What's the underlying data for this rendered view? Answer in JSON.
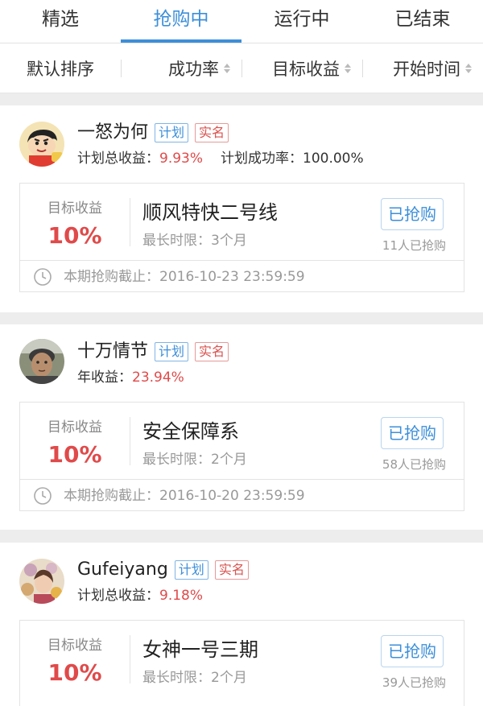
{
  "tabs": [
    "精选",
    "抢购中",
    "运行中",
    "已结束"
  ],
  "active_tab": 1,
  "sort": [
    "默认排序",
    "成功率",
    "目标收益",
    "开始时间"
  ],
  "colors": {
    "accent": "#3d8fd9",
    "red": "#e04a4a"
  },
  "cards": [
    {
      "name": "一怒为何",
      "tag_plan": "计划",
      "tag_real": "实名",
      "stat1_label": "计划总收益：",
      "stat1_value": "9.93%",
      "stat2_label": "计划成功率：",
      "stat2_value": "100.00%",
      "target_label": "目标收益",
      "target_value": "10%",
      "product": "顺风特快二号线",
      "duration": "最长时限：3个月",
      "button": "已抢购",
      "buyers": "11人已抢购",
      "deadline": "本期抢购截止：2016-10-23 23:59:59"
    },
    {
      "name": "十万情节",
      "tag_plan": "计划",
      "tag_real": "实名",
      "stat1_label": "年收益：",
      "stat1_value": "23.94%",
      "target_label": "目标收益",
      "target_value": "10%",
      "product": "安全保障系",
      "duration": "最长时限：2个月",
      "button": "已抢购",
      "buyers": "58人已抢购",
      "deadline": "本期抢购截止：2016-10-20 23:59:59"
    },
    {
      "name": "Gufeiyang",
      "tag_plan": "计划",
      "tag_real": "实名",
      "stat1_label": "计划总收益：",
      "stat1_value": "9.18%",
      "target_label": "目标收益",
      "target_value": "10%",
      "product": "女神一号三期",
      "duration": "最长时限：2个月",
      "button": "已抢购",
      "buyers": "39人已抢购"
    }
  ]
}
